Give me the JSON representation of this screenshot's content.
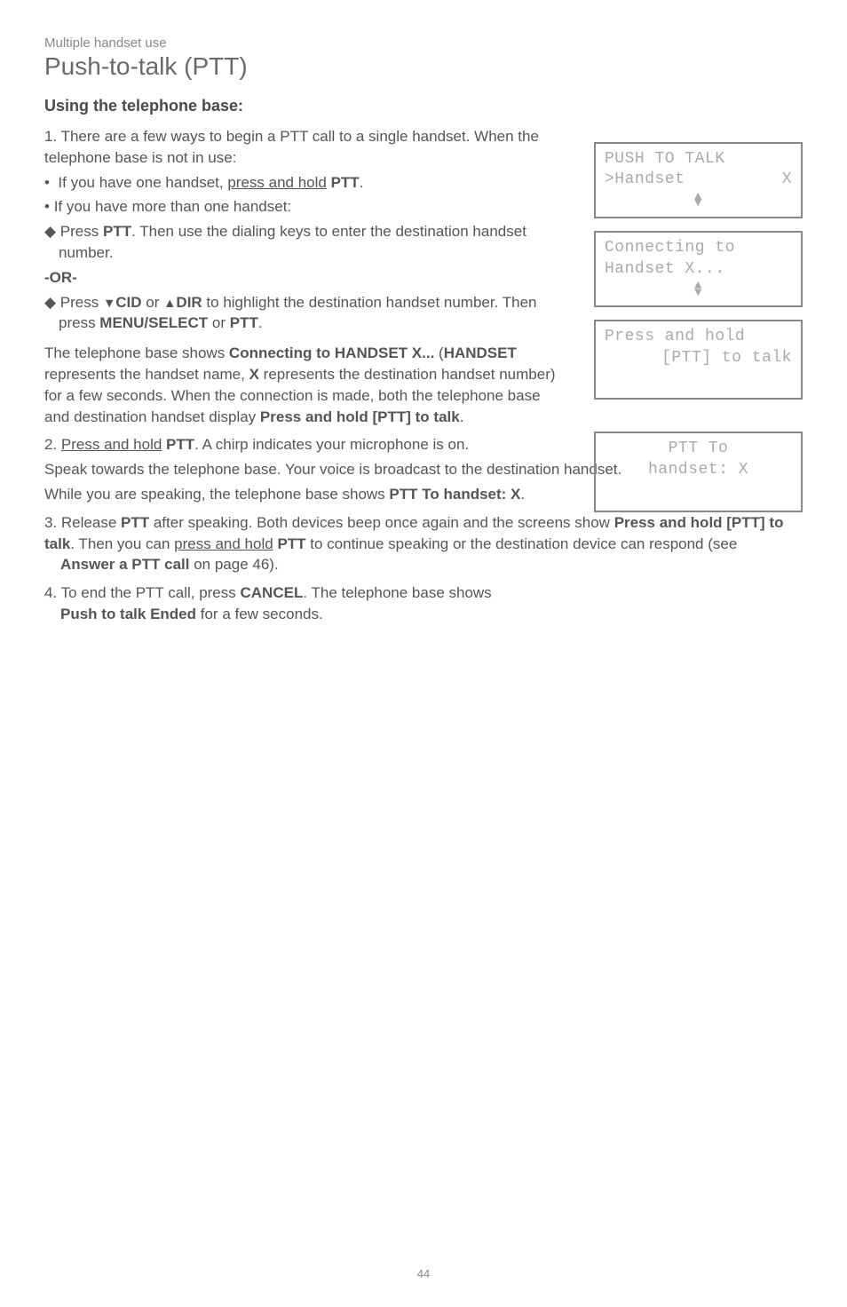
{
  "breadcrumb": "Multiple handset use",
  "title": "Push-to-talk (PTT)",
  "heading": "Using the telephone base:",
  "step1_lead": "1. There are a few ways to begin a PTT call to a single handset. When the telephone base is not in use:",
  "b1_a_pre": "If you have one handset, ",
  "b1_a_uline": "press and hold",
  "b1_a_post": " PTT",
  "b1_a_dot": ".",
  "b1_b": "If you have more than one handset:",
  "b2_a_pre": "Press ",
  "b2_a_btn": "PTT",
  "b2_a_post": ". Then use the dialing keys to enter the destination handset number.",
  "or": "-OR-",
  "b2_b_pre": "Press ",
  "b2_b_cid": "CID",
  "b2_b_or": " or ",
  "b2_b_dir": "DIR",
  "b2_b_mid": " to highlight the destination handset number. Then press ",
  "b2_b_menu": "MENU",
  "b2_b_select": "/SELECT",
  "b2_b_or2": " or ",
  "b2_b_ptt": "PTT",
  "b2_b_end": ".",
  "para1_a": "The telephone base shows ",
  "para1_b": "Connecting to HANDSET X...",
  "para1_c": " (",
  "para1_d": "HANDSET",
  "para1_e": " represents the handset name, ",
  "para1_f": "X",
  "para1_g": " represents the destination handset number) for a few seconds. When the connection is made, both the telephone base and destination handset display ",
  "para1_h": "Press and hold [PTT] to talk",
  "para1_i": ".",
  "step2_a": "2. ",
  "step2_u": "Press and hold",
  "step2_b": " ",
  "step2_ptt": "PTT",
  "step2_c": ". A chirp indicates your microphone is on.",
  "step2_p2": "Speak towards the telephone base. Your voice is broadcast to the destination handset.",
  "step2_p3a": "While you are speaking, the telephone base shows ",
  "step2_p3b": "PTT To handset: X",
  "step2_p3c": ".",
  "step3_a": "3. Release ",
  "step3_ptt": "PTT",
  "step3_b": " after speaking. Both devices beep once again and the screens show ",
  "step3_c": "Press and hold [PTT] to talk",
  "step3_d": ". Then you can ",
  "step3_u": "press and hold",
  "step3_e": " ",
  "step3_ptt2": "PTT",
  "step3_f": " to continue speaking or the destination device can respond (see ",
  "step3_g": "Answer a PTT call",
  "step3_h": " on page 46).",
  "step4_a": "4. To end the PTT call, press ",
  "step4_b": "CANCEL",
  "step4_c": ". The telephone base shows ",
  "step4_d": "Push to talk Ended",
  "step4_e": " for a few seconds.",
  "lcd1_l1a": "PUSH TO TALK",
  "lcd1_l2a": ">Handset",
  "lcd1_l2b": "X",
  "lcd2_l1": "Connecting to",
  "lcd2_l2": "Handset X...",
  "lcd3_l1": "Press and hold",
  "lcd3_l2": "[PTT] to talk",
  "lcd4_l1": "PTT To",
  "lcd4_l2": "handset: X",
  "pagenum": "44"
}
